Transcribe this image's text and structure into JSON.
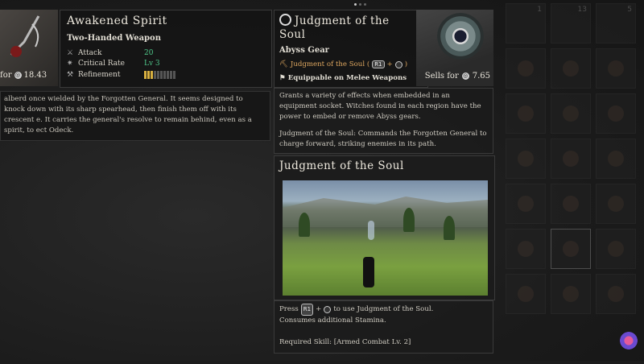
{
  "left_item": {
    "title": "Awakened Spirit",
    "type": "Two-Handed Weapon",
    "stats": [
      {
        "label": "Attack",
        "value": "20",
        "icon": "sword-icon"
      },
      {
        "label": "Critical Rate",
        "value": "Lv 3",
        "icon": "crit-icon"
      },
      {
        "label": "Refinement",
        "value": "",
        "icon": "refine-icon"
      }
    ],
    "refinement_level": 3,
    "refinement_max": 10,
    "sell_label": "for",
    "sell_price": "18.43",
    "description": "alberd once wielded by the Forgotten General. It seems designed to knock down with its sharp spearhead, then finish them off with its crescent e. It carries the general's resolve to remain behind, even as a spirit, to ect Odeck."
  },
  "gear": {
    "title": "Judgment of the Soul",
    "type": "Abyss Gear",
    "skill_line": "Judgment of the Soul (",
    "skill_line_end": ")",
    "button_r1": "R1",
    "plus": "+",
    "equip_line": "Equippable on Melee Weapons",
    "sell_label": "Sells for",
    "sell_price": "7.65",
    "desc_p1": "Grants a variety of effects when embedded in an equipment socket. Witches found in each region have the power to embed or remove Abyss gears.",
    "desc_p2": "Judgment of the Soul: Commands the Forgotten General to charge forward, striking enemies in its path.",
    "video_title": "Judgment of the Soul",
    "press_prefix": "Press",
    "press_suffix": "to use Judgment of the Soul.",
    "stamina_line": "Consumes additional Stamina.",
    "required_skill": "Required Skill: [Armed Combat Lv. 2]"
  },
  "inventory_numbers": [
    "1",
    "13",
    "5"
  ],
  "colors": {
    "stat_value": "#4fc78a",
    "skill_orange": "#e0a860",
    "refine_on": "#d8b040"
  }
}
